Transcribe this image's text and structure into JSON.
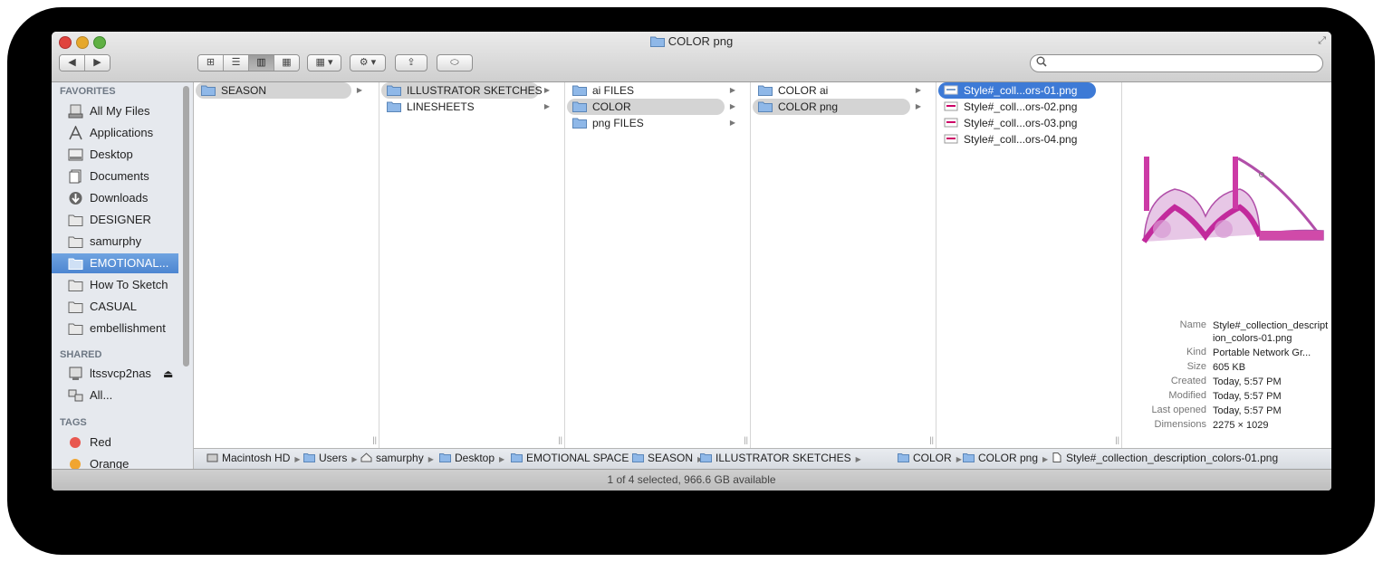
{
  "window": {
    "title": "COLOR png"
  },
  "toolbar": {
    "back": "◀",
    "forward": "▶",
    "views": [
      "⊞",
      "☰",
      "▥",
      "▦"
    ],
    "arrange": "▦ ▾",
    "action": "⚙ ▾",
    "share": "⇪",
    "tags": "⬭",
    "search_placeholder": ""
  },
  "sidebar": {
    "favorites_title": "FAVORITES",
    "favorites": [
      {
        "label": "All My Files",
        "icon": "all-files-icon"
      },
      {
        "label": "Applications",
        "icon": "applications-icon"
      },
      {
        "label": "Desktop",
        "icon": "desktop-icon"
      },
      {
        "label": "Documents",
        "icon": "documents-icon"
      },
      {
        "label": "Downloads",
        "icon": "downloads-icon"
      },
      {
        "label": "DESIGNER",
        "icon": "folder-icon"
      },
      {
        "label": "samurphy",
        "icon": "folder-icon"
      },
      {
        "label": "EMOTIONAL...",
        "icon": "folder-icon"
      },
      {
        "label": "How To Sketch",
        "icon": "folder-icon"
      },
      {
        "label": "CASUAL",
        "icon": "folder-icon"
      },
      {
        "label": "embellishment",
        "icon": "folder-icon"
      }
    ],
    "shared_title": "SHARED",
    "shared": [
      {
        "label": "ltssvcp2nas",
        "icon": "server-icon"
      },
      {
        "label": "All...",
        "icon": "network-icon"
      }
    ],
    "tags_title": "TAGS",
    "tags": [
      {
        "label": "Red",
        "color": "#e8574f"
      },
      {
        "label": "Orange",
        "color": "#f0a530"
      }
    ]
  },
  "columns": [
    {
      "items": [
        {
          "label": "SEASON",
          "state": "highlighted",
          "folder": true
        }
      ]
    },
    {
      "items": [
        {
          "label": "ILLUSTRATOR SKETCHES",
          "state": "highlighted",
          "folder": true
        },
        {
          "label": "LINESHEETS",
          "state": "",
          "folder": true
        }
      ]
    },
    {
      "items": [
        {
          "label": "ai FILES",
          "state": "",
          "folder": true
        },
        {
          "label": "COLOR",
          "state": "highlighted",
          "folder": true
        },
        {
          "label": "png FILES",
          "state": "",
          "folder": true
        }
      ]
    },
    {
      "items": [
        {
          "label": "COLOR ai",
          "state": "",
          "folder": true
        },
        {
          "label": "COLOR png",
          "state": "highlighted",
          "folder": true
        }
      ]
    },
    {
      "items": [
        {
          "label": "Style#_coll...ors-01.png",
          "state": "selected",
          "folder": false
        },
        {
          "label": "Style#_coll...ors-02.png",
          "state": "",
          "folder": false
        },
        {
          "label": "Style#_coll...ors-03.png",
          "state": "",
          "folder": false
        },
        {
          "label": "Style#_coll...ors-04.png",
          "state": "",
          "folder": false
        }
      ]
    }
  ],
  "preview": {
    "name_label": "Name",
    "name_value": "Style#_collection_description_colors-01.png",
    "kind_label": "Kind",
    "kind_value": "Portable Network Gr...",
    "size_label": "Size",
    "size_value": "605 KB",
    "created_label": "Created",
    "created_value": "Today, 5:57 PM",
    "modified_label": "Modified",
    "modified_value": "Today, 5:57 PM",
    "opened_label": "Last opened",
    "opened_value": "Today, 5:57 PM",
    "dimensions_label": "Dimensions",
    "dimensions_value": "2275 × 1029"
  },
  "pathbar": [
    {
      "label": "Macintosh HD",
      "icon": "disk-icon"
    },
    {
      "label": "Users",
      "icon": "users-folder-icon"
    },
    {
      "label": "samurphy",
      "icon": "home-icon"
    },
    {
      "label": "Desktop",
      "icon": "folder-icon"
    },
    {
      "label": "EMOTIONAL SPACE",
      "icon": "folder-icon"
    },
    {
      "label": "SEASON",
      "icon": "folder-icon"
    },
    {
      "label": "ILLUSTRATOR SKETCHES",
      "icon": "folder-icon"
    },
    {
      "label": "COLOR",
      "icon": "folder-icon"
    },
    {
      "label": "COLOR png",
      "icon": "folder-icon"
    },
    {
      "label": "Style#_collection_description_colors-01.png",
      "icon": "file-icon"
    }
  ],
  "status": "1 of 4 selected, 966.6 GB available"
}
